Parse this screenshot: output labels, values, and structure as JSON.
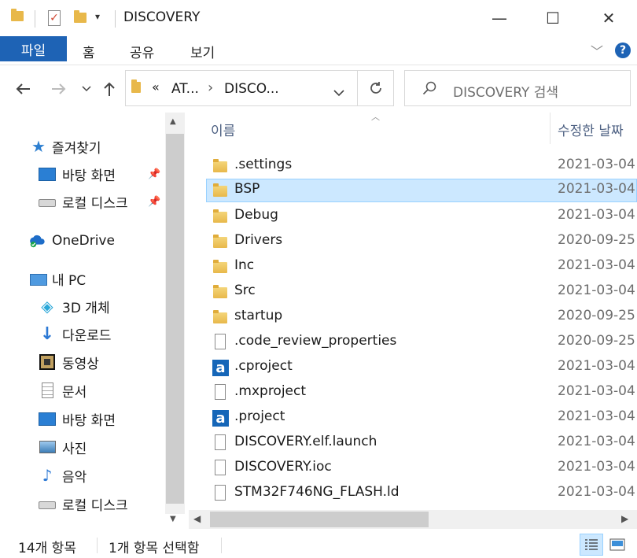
{
  "window": {
    "title": "DISCOVERY",
    "minimize_glyph": "—",
    "maximize_glyph": "☐",
    "close_glyph": "✕"
  },
  "ribbon": {
    "tabs": [
      "파일",
      "홈",
      "공유",
      "보기"
    ],
    "help_glyph": "?"
  },
  "address": {
    "overflow_glyph": "«",
    "crumbs": [
      "AT...",
      "DISCO..."
    ],
    "separator": "›"
  },
  "search": {
    "placeholder": "DISCOVERY 검색"
  },
  "nav_pane": {
    "items": [
      {
        "label": "즐겨찾기",
        "icon": "star-icon"
      },
      {
        "label": "바탕 화면",
        "icon": "desktop-icon",
        "pinned": true
      },
      {
        "label": "로컬 디스크",
        "icon": "drive-icon",
        "pinned": true
      },
      {
        "label": "OneDrive",
        "icon": "onedrive-icon"
      },
      {
        "label": "내 PC",
        "icon": "pc-icon"
      },
      {
        "label": "3D 개체",
        "icon": "3d-objects-icon"
      },
      {
        "label": "다운로드",
        "icon": "download-icon"
      },
      {
        "label": "동영상",
        "icon": "video-icon"
      },
      {
        "label": "문서",
        "icon": "document-icon"
      },
      {
        "label": "바탕 화면",
        "icon": "desktop-icon"
      },
      {
        "label": "사진",
        "icon": "pictures-icon"
      },
      {
        "label": "음악",
        "icon": "music-icon"
      },
      {
        "label": "로컬 디스크",
        "icon": "drive-icon"
      }
    ]
  },
  "file_list": {
    "columns": [
      "이름",
      "수정한 날짜"
    ],
    "rows": [
      {
        "name": ".settings",
        "date": "2021-03-04",
        "type": "folder"
      },
      {
        "name": "BSP",
        "date": "2021-03-04",
        "type": "folder",
        "selected": true
      },
      {
        "name": "Debug",
        "date": "2021-03-04",
        "type": "folder"
      },
      {
        "name": "Drivers",
        "date": "2020-09-25",
        "type": "folder"
      },
      {
        "name": "Inc",
        "date": "2021-03-04",
        "type": "folder"
      },
      {
        "name": "Src",
        "date": "2021-03-04",
        "type": "folder"
      },
      {
        "name": "startup",
        "date": "2020-09-25",
        "type": "folder"
      },
      {
        "name": ".code_review_properties",
        "date": "2020-09-25",
        "type": "file"
      },
      {
        "name": ".cproject",
        "date": "2021-03-04",
        "type": "app"
      },
      {
        "name": ".mxproject",
        "date": "2021-03-04",
        "type": "file"
      },
      {
        "name": ".project",
        "date": "2021-03-04",
        "type": "app"
      },
      {
        "name": "DISCOVERY.elf.launch",
        "date": "2021-03-04",
        "type": "file"
      },
      {
        "name": "DISCOVERY.ioc",
        "date": "2021-03-04",
        "type": "file"
      },
      {
        "name": "STM32F746NG_FLASH.ld",
        "date": "2021-03-04",
        "type": "file"
      }
    ]
  },
  "status_bar": {
    "item_count": "14개 항목",
    "selection": "1개 항목 선택함"
  },
  "colors": {
    "accent": "#1e63b5",
    "selection_bg": "#cce8ff",
    "folder": "#e8b84a"
  }
}
